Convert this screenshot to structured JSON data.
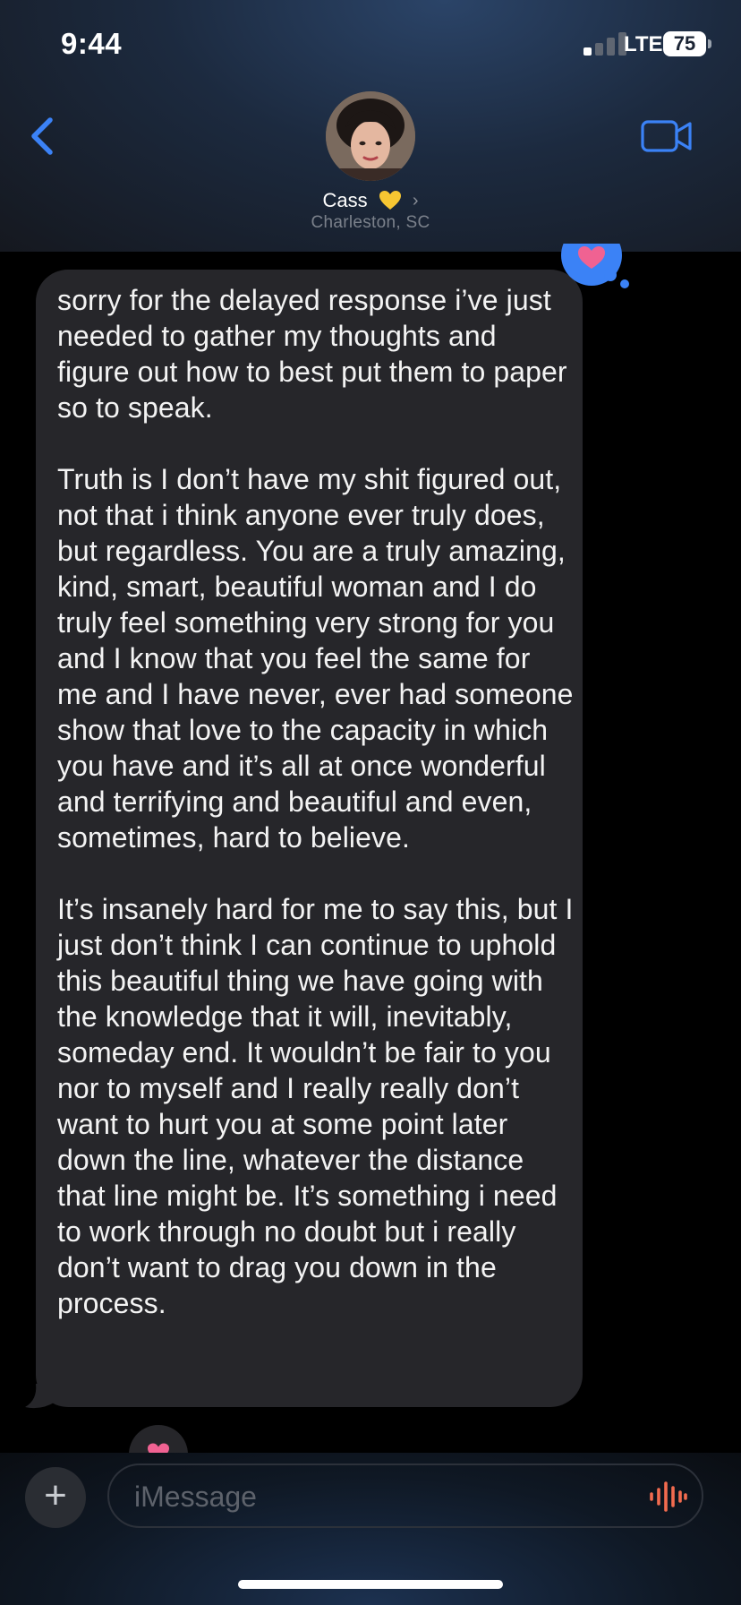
{
  "status_bar": {
    "time": "9:44",
    "network": "LTE",
    "battery": "75",
    "signal_bars_active": 1,
    "signal_bars_total": 4
  },
  "header": {
    "contact_name": "Cass",
    "contact_emoji": "yellow-heart",
    "location": "Charleston, SC",
    "back_icon": "chevron-left-icon",
    "video_icon": "video-camera-icon"
  },
  "message": {
    "direction": "incoming",
    "text": "sorry for the delayed response i’ve just needed to gather my thoughts and figure out how to best put them to paper so to speak.\n\nTruth is I don’t have my shit figured out, not that i think anyone ever truly does, but regardless. You are a truly amazing, kind, smart, beautiful woman and I do truly feel something very strong for you and I know that you feel the same for me and I have never, ever had someone show that love to the capacity in which you have and it’s all at once wonderful and terrifying and beautiful and even, sometimes, hard to believe.\n\nIt’s insanely hard for me to say this, but I just don’t think I can continue to uphold this beautiful thing we have going with the knowledge that it will, inevitably, someday end. It wouldn’t be fair to you nor to myself and I really really don’t want to hurt you at some point later down the line, whatever the distance that line might be. It’s something i need to work through no doubt but i really don’t want to drag you down in the process.",
    "tapback": "heart"
  },
  "input": {
    "placeholder": "iMessage",
    "value": ""
  },
  "colors": {
    "accent_blue": "#3b82f6",
    "bubble_gray": "#26262a",
    "tapback_pink": "#f06292",
    "audio_orange": "#f26b4f"
  }
}
